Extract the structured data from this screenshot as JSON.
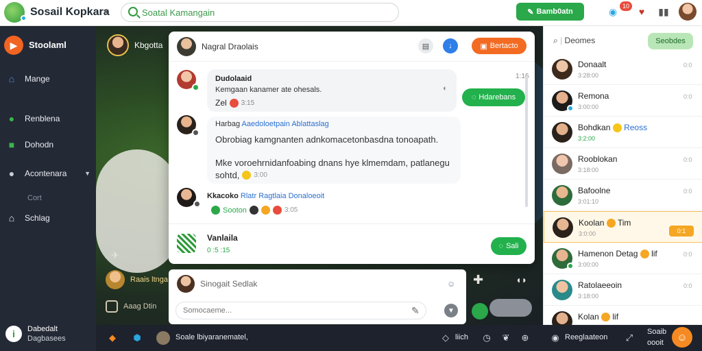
{
  "app": {
    "title": "Sosail Kopkara",
    "close": "×"
  },
  "search": {
    "placeholder": "Soatal Kamangain"
  },
  "topbar": {
    "primary_button": "Bamb0atn",
    "notification_count": "10"
  },
  "sidebar": {
    "brand": "Stoolaml",
    "items": [
      {
        "label": "Mange"
      },
      {
        "label": "Renblena"
      },
      {
        "label": "Dohodn"
      },
      {
        "label": "Acontenara"
      },
      {
        "label": "Schlag"
      }
    ],
    "sub_label": "Cort",
    "footer_line1": "Dabedalt",
    "footer_line2": "Dagbasees"
  },
  "scene": {
    "user_name": "Kbgotta",
    "row1_text": "Raais ltnga",
    "row2_text": "Aaag Dtin"
  },
  "chat": {
    "header_title": "Nagral Draolais",
    "header_button": "Bertacto",
    "messages": [
      {
        "name": "Dudolaaid",
        "text": "Kemgaan kanamer ate ohesals.",
        "meta": "Zel",
        "meta2": "3:15",
        "time": "1:16",
        "action": "Hdarebans"
      },
      {
        "name": "Harbag",
        "link": "Aaedoloetpain Ablattaslag",
        "line1": "Obrobiag kamgnanten adnkomacetonbasdna tonoapath.",
        "line2": "Mke voroehrnidanfoabing dnans hye klmemdam, patlanegu",
        "line3": "sohtd,",
        "meta": "3:00"
      },
      {
        "name": "Kkacoko",
        "highlight": "Rlatr Ragtlaia Donaloeoit",
        "reaction_label": "Sooton",
        "meta": "3:05"
      }
    ],
    "footer_name": "Vanlaila",
    "footer_meta": "0 :5 :15",
    "footer_action": "Sali"
  },
  "composer": {
    "label": "Sinogait Sedlak",
    "placeholder": "Somocaeme..."
  },
  "right_panel": {
    "search_label": "Deomes",
    "button": "Seobdes",
    "contacts": [
      {
        "name": "Donaalt",
        "sub": "3:28:00",
        "time": "0:0"
      },
      {
        "name": "Remona",
        "sub": "3:00:00",
        "time": "0:0"
      },
      {
        "name": "Bohdkan",
        "extra": "Reoss",
        "sub": "3:2:00",
        "time": ""
      },
      {
        "name": "Rooblokan",
        "sub": "3:18:00",
        "time": "0:0"
      },
      {
        "name": "Bafoolne",
        "sub": "3:01:10",
        "time": "0:0"
      },
      {
        "name": "Koolan",
        "extra": "Tim",
        "sub": "3:0:00",
        "tag": "0:1"
      },
      {
        "name": "Hamenon Detag",
        "extra": "lif",
        "sub": "3:00:00",
        "time": "0:0"
      },
      {
        "name": "Ratolaeeoin",
        "sub": "3:18:00",
        "time": "0:0"
      },
      {
        "name": "Kolan",
        "extra": "lif",
        "sub": "",
        "time": ""
      }
    ]
  },
  "bottombar": {
    "status_text": "Soale lbiyaranematel,",
    "mid_text": "liich",
    "right_text": "Reeglaateon",
    "corner_text_1": "Soaib",
    "corner_text_2": "oooit"
  },
  "colors": {
    "brand_green": "#2aa84a",
    "accent_orange": "#f36b22",
    "sidebar_bg": "#242936",
    "active_contact": "#f5c15a"
  }
}
